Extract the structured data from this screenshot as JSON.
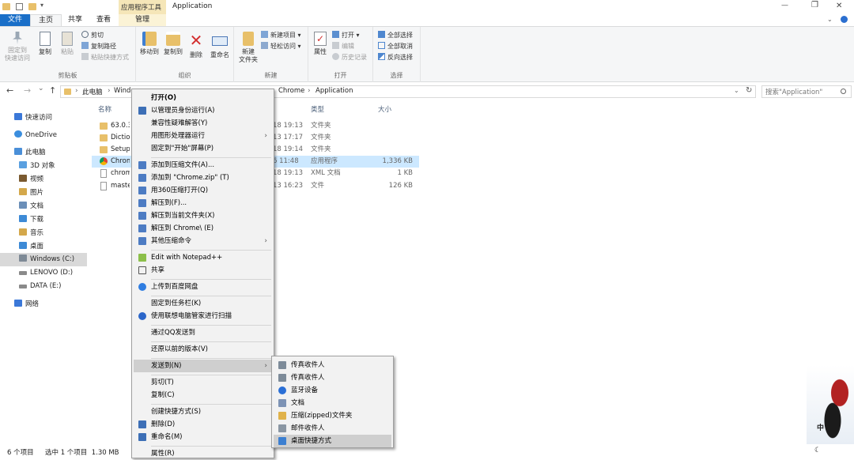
{
  "title_bar": {
    "context_tab": "应用程序工具",
    "window_title": "Application",
    "minimize": "—",
    "restore": "❐",
    "close": "✕"
  },
  "ribbon_tabs": [
    "文件",
    "主页",
    "共享",
    "查看",
    "管理"
  ],
  "ribbon": {
    "clipboard": {
      "label": "剪贴板",
      "pin_line1": "固定到",
      "pin_line2": "快速访问",
      "copy": "复制",
      "paste": "粘贴",
      "cut": "剪切",
      "copy_path": "复制路径",
      "paste_shortcut": "粘贴快捷方式"
    },
    "organize": {
      "label": "组织",
      "move_to": "移动到",
      "copy_to": "复制到",
      "delete": "删除",
      "rename": "重命名"
    },
    "new": {
      "label": "新建",
      "new_folder_line1": "新建",
      "new_folder_line2": "文件夹",
      "new_item": "新建项目 ▾",
      "easy_access": "轻松访问 ▾"
    },
    "open": {
      "label": "打开",
      "properties": "属性",
      "open": "打开 ▾",
      "edit": "编辑",
      "history": "历史记录"
    },
    "select": {
      "label": "选择",
      "select_all": "全部选择",
      "select_none": "全部取消",
      "invert": "反向选择"
    }
  },
  "navigation": {
    "back": "←",
    "forward": "→",
    "recent": "⌄",
    "up": "↑",
    "breadcrumb": [
      "此电脑",
      "Windo",
      "Chrome",
      "Application"
    ],
    "search_placeholder": "搜索\"Application\""
  },
  "nav_pane": [
    {
      "label": "快速访问",
      "color": "#3b78d8"
    },
    {
      "label": "OneDrive",
      "color": "#3b8ede"
    },
    {
      "label": "此电脑",
      "color": "#4a8fd8"
    },
    {
      "label": "3D 对象",
      "color": "#5aa0e0"
    },
    {
      "label": "视频",
      "color": "#7a5a30"
    },
    {
      "label": "图片",
      "color": "#d4a84b"
    },
    {
      "label": "文档",
      "color": "#6b8fb8"
    },
    {
      "label": "下载",
      "color": "#3d8ad6"
    },
    {
      "label": "音乐",
      "color": "#d4a84b"
    },
    {
      "label": "桌面",
      "color": "#3d8ad6"
    },
    {
      "label": "Windows (C:)",
      "color": "#7e8a96"
    },
    {
      "label": "LENOVO (D:)",
      "color": "#8a8a8a"
    },
    {
      "label": "DATA (E:)",
      "color": "#8a8a8a"
    },
    {
      "label": "网络",
      "color": "#3b78d8"
    }
  ],
  "columns": {
    "name": "名称",
    "type": "类型",
    "size": "大小"
  },
  "files": [
    {
      "name": "63.0.3",
      "date": "18 19:13",
      "type": "文件夹",
      "size": "",
      "icon": "folder"
    },
    {
      "name": "Dictio",
      "date": "13 17:17",
      "type": "文件夹",
      "size": "",
      "icon": "folder"
    },
    {
      "name": "SetupI",
      "date": "18 19:14",
      "type": "文件夹",
      "size": "",
      "icon": "folder"
    },
    {
      "name": "Chrom",
      "date": "6 11:48",
      "type": "应用程序",
      "size": "1,336 KB",
      "icon": "chrome"
    },
    {
      "name": "chrom",
      "date": "18 19:13",
      "type": "XML 文档",
      "size": "1 KB",
      "icon": "doc"
    },
    {
      "name": "maste",
      "date": "13 16:23",
      "type": "文件",
      "size": "126 KB",
      "icon": "doc"
    }
  ],
  "status": {
    "count": "6 个项目",
    "selected": "选中 1 个项目  1.30 MB"
  },
  "context_menu": [
    {
      "label": "打开(O)",
      "bold": true,
      "icon": ""
    },
    {
      "label": "以管理员身份运行(A)",
      "icon": "#3d6fb6"
    },
    {
      "label": "兼容性疑难解答(Y)",
      "icon": ""
    },
    {
      "label": "用图形处理器运行",
      "icon": "",
      "arrow": "›"
    },
    {
      "label": "固定到\"开始\"屏幕(P)",
      "icon": ""
    },
    {
      "label": "添加到压缩文件(A)...",
      "icon": "#4d7cc3"
    },
    {
      "label": "添加到 \"Chrome.zip\" (T)",
      "icon": "#4d7cc3"
    },
    {
      "label": "用360压缩打开(Q)",
      "icon": "#4d7cc3"
    },
    {
      "label": "解压到(F)...",
      "icon": "#4d7cc3"
    },
    {
      "label": "解压到当前文件夹(X)",
      "icon": "#4d7cc3"
    },
    {
      "label": "解压到 Chrome\\ (E)",
      "icon": "#4d7cc3"
    },
    {
      "label": "其他压缩命令",
      "icon": "#4d7cc3",
      "arrow": "›"
    },
    {
      "label": "Edit with Notepad++",
      "icon": "#8cbf4a"
    },
    {
      "label": "共享",
      "icon": "#555555"
    },
    {
      "label": "上传到百度网盘",
      "icon": "#2f7de1"
    },
    {
      "label": "固定到任务栏(K)",
      "icon": ""
    },
    {
      "label": "使用联想电脑管家进行扫描",
      "icon": "#2b66c9"
    },
    {
      "label": "通过QQ发送到",
      "icon": ""
    },
    {
      "label": "还原以前的版本(V)",
      "icon": ""
    },
    {
      "label": "发送到(N)",
      "icon": "",
      "arrow": "›"
    },
    {
      "label": "剪切(T)",
      "icon": ""
    },
    {
      "label": "复制(C)",
      "icon": ""
    },
    {
      "label": "创建快捷方式(S)",
      "icon": ""
    },
    {
      "label": "删除(D)",
      "icon": "#3d6fb6"
    },
    {
      "label": "重命名(M)",
      "icon": "#3d6fb6"
    },
    {
      "label": "属性(R)",
      "icon": ""
    }
  ],
  "send_to_menu": [
    {
      "label": "传真收件人",
      "icon": "#7d8b99"
    },
    {
      "label": "传真收件人",
      "icon": "#7d8b99"
    },
    {
      "label": "蓝牙设备",
      "icon": "#2a6fd6"
    },
    {
      "label": "文档",
      "icon": "#7d93b5"
    },
    {
      "label": "压缩(zipped)文件夹",
      "icon": "#e0b24a"
    },
    {
      "label": "邮件收件人",
      "icon": "#8a96a3"
    },
    {
      "label": "桌面快捷方式",
      "icon": "#3c7fd1"
    }
  ],
  "desktop_widget": {
    "text": "中",
    "moon": "☾"
  }
}
